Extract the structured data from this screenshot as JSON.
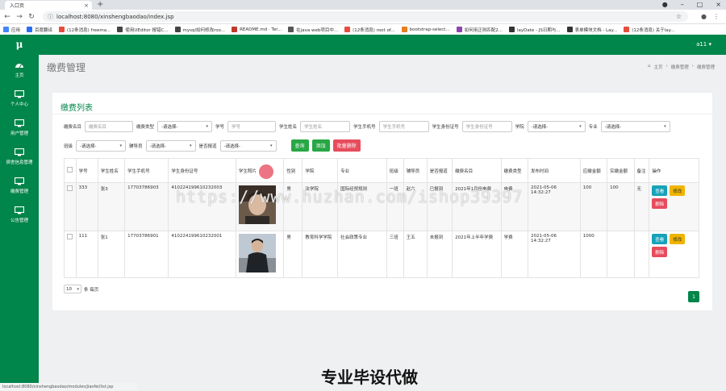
{
  "browser": {
    "tab_title": "入口页",
    "url": "localhost:8080/xinshengbaodao/index.jsp",
    "status_url": "localhost:8080/xinshengbaodao/modules/jiaofei/list.jsp",
    "bookmarks": [
      {
        "label": "应用",
        "color": "#4285f4"
      },
      {
        "label": "百度翻译",
        "color": "#2a6ef5"
      },
      {
        "label": "(12条消息) freema...",
        "color": "#e74c3c"
      },
      {
        "label": "使用UEditor 报错C...",
        "color": "#444444"
      },
      {
        "label": "mysql如何修改roo...",
        "color": "#444444"
      },
      {
        "label": "README.md · Ter...",
        "color": "#c0392b"
      },
      {
        "label": "在java web项目中...",
        "color": "#555555"
      },
      {
        "label": "(12条消息) root of...",
        "color": "#e74c3c"
      },
      {
        "label": "bootstrap-select...",
        "color": "#e67e22"
      },
      {
        "label": "如何用正则匹配2...",
        "color": "#8e44ad"
      },
      {
        "label": "layDate - JS日期与...",
        "color": "#333333"
      },
      {
        "label": "表单模块文档 - Lay...",
        "color": "#333333"
      },
      {
        "label": "(12条消息) 关于lay...",
        "color": "#e74c3c"
      }
    ]
  },
  "app": {
    "logo": "μ",
    "user": "a11 ▾",
    "page_title": "缴费管理",
    "breadcrumb": {
      "home": "主页",
      "parent": "缴费管理",
      "current": "缴费管理"
    },
    "sidebar": [
      {
        "label": "主页",
        "icon": "dashboard-icon"
      },
      {
        "label": "个人中心",
        "icon": "monitor-icon"
      },
      {
        "label": "用户管理",
        "icon": "monitor-icon"
      },
      {
        "label": "宿舍信息管理",
        "icon": "monitor-icon"
      },
      {
        "label": "缴费管理",
        "icon": "monitor-icon"
      },
      {
        "label": "公告管理",
        "icon": "monitor-icon"
      }
    ]
  },
  "card": {
    "title": "缴费列表",
    "filters_row1": [
      {
        "label": "缴费名目",
        "type": "input",
        "placeholder": "缴费名目"
      },
      {
        "label": "缴费类型",
        "type": "select",
        "value": "-请选择-"
      },
      {
        "label": "学号",
        "type": "input",
        "placeholder": "学号"
      },
      {
        "label": "学生姓名",
        "type": "input",
        "placeholder": "学生姓名"
      },
      {
        "label": "学生手机号",
        "type": "input",
        "placeholder": "学生手机号"
      },
      {
        "label": "学生身份证号",
        "type": "input",
        "placeholder": "学生身份证号"
      },
      {
        "label": "学院",
        "type": "select",
        "value": "-请选择-"
      },
      {
        "label": "专业",
        "type": "select",
        "value": "-请选择-"
      }
    ],
    "filters_row2": [
      {
        "label": "班级",
        "type": "select",
        "value": "-请选择-"
      },
      {
        "label": "辅导员",
        "type": "select",
        "value": "-请选择-"
      },
      {
        "label": "是否报道",
        "type": "select",
        "value": "-请选择-"
      }
    ],
    "buttons": {
      "query": "查询",
      "add": "添加",
      "batch_delete": "批量删除"
    },
    "columns": [
      "学号",
      "学生姓名",
      "学生手机号",
      "学生身份证号",
      "学生照片",
      "性别",
      "学院",
      "专业",
      "班级",
      "辅导员",
      "是否报道",
      "缴费名目",
      "缴费类型",
      "发布时间",
      "应缴金额",
      "实缴金额",
      "备注",
      "操作"
    ],
    "rows": [
      {
        "id": "333",
        "name": "张3",
        "phone": "17703786903",
        "idcard": "410224199610232003",
        "gender": "男",
        "college": "法学院",
        "major": "国际经贸规则",
        "class": "一班",
        "counselor": "赵六",
        "reported": "已报到",
        "item": "2021年1月份电费",
        "fee_type": "电费",
        "time": "2021-05-06 14:32:27",
        "due": "100",
        "paid": "100",
        "remark": "无"
      },
      {
        "id": "111",
        "name": "张1",
        "phone": "17703786901",
        "idcard": "410224199610232001",
        "gender": "男",
        "college": "教育科学学院",
        "major": "社会政策专业",
        "class": "三班",
        "counselor": "王五",
        "reported": "未报到",
        "item": "2021年上半年学费",
        "fee_type": "学费",
        "time": "2021-05-06 14:32:27",
        "due": "1000",
        "paid": "",
        "remark": ""
      }
    ],
    "op_buttons": {
      "view": "查看",
      "edit": "修改",
      "delete": "删除"
    },
    "page_size": "10",
    "page_size_suffix": "条 每页",
    "current_page": "1"
  },
  "overlay": {
    "watermark": "https://www.huzhan.com/ishop39397",
    "caption": "专业毕设代做"
  },
  "colors": {
    "brand": "#00854a",
    "danger": "#e74c5c",
    "info": "#17a2b8",
    "warning": "#f0b400"
  }
}
